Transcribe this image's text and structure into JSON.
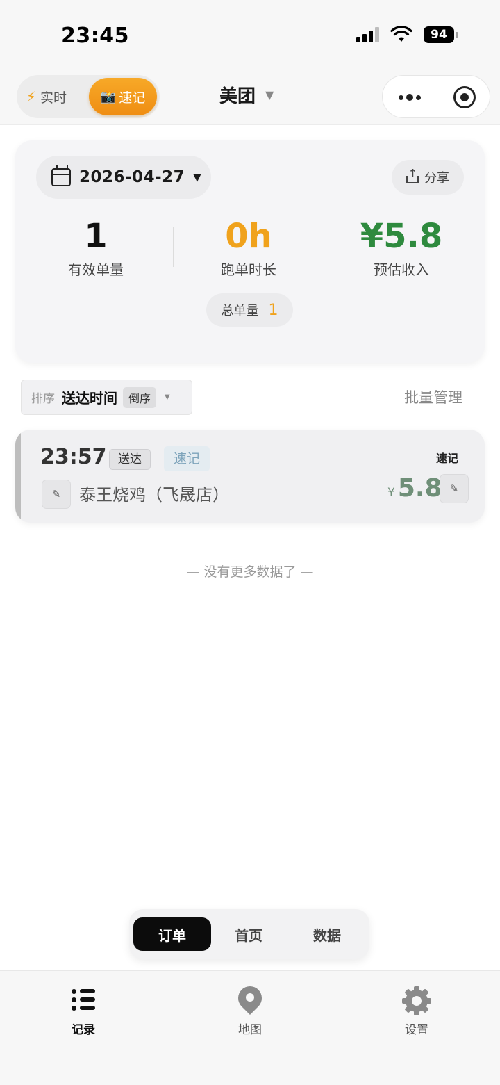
{
  "status_bar": {
    "time": "23:45",
    "battery": "94"
  },
  "header": {
    "mode_realtime": "实时",
    "mode_quick": "速记",
    "platform": "美团"
  },
  "summary": {
    "date": "2026-04-27",
    "share_label": "分享",
    "stats": [
      {
        "value": "1",
        "label": "有效单量",
        "color": "#111111"
      },
      {
        "value": "0h",
        "label": "跑单时长",
        "color": "#f0a21c"
      },
      {
        "value": "¥5.8",
        "label": "预估收入",
        "color": "#2e8a3e"
      }
    ],
    "total_label": "总单量",
    "total_value": "1"
  },
  "sort": {
    "label": "排序",
    "field": "送达时间",
    "order": "倒序",
    "batch": "批量管理"
  },
  "orders": [
    {
      "time": "23:57",
      "status": "送达",
      "source": "速记",
      "shop": "泰王烧鸡（飞晟店）",
      "source_label": "速记",
      "currency": "¥",
      "amount": "5.8"
    }
  ],
  "no_more": "— 没有更多数据了 —",
  "segmented": {
    "items": [
      "订单",
      "首页",
      "数据"
    ],
    "active": 0
  },
  "tabbar": {
    "items": [
      {
        "label": "记录",
        "icon": "list-icon"
      },
      {
        "label": "地图",
        "icon": "map-pin-icon"
      },
      {
        "label": "设置",
        "icon": "gear-icon"
      }
    ]
  },
  "colors": {
    "accent": "#f0a21c",
    "income": "#2e8a3e"
  }
}
